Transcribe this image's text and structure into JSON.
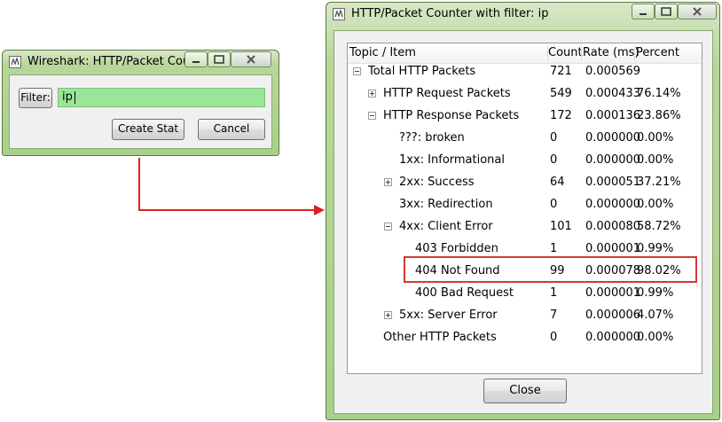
{
  "small_window": {
    "title": "Wireshark: HTTP/Packet Count…",
    "filter_label": "Filter:",
    "filter_value": "ip",
    "create_stat_label": "Create Stat",
    "cancel_label": "Cancel"
  },
  "main_window": {
    "title": "HTTP/Packet Counter with filter: ip",
    "columns": [
      "Topic / Item",
      "Count",
      "Rate (ms)",
      "Percent"
    ],
    "rows": [
      {
        "label": "Total HTTP Packets",
        "count": "721",
        "rate": "0.000569",
        "percent": ""
      },
      {
        "label": "HTTP Request Packets",
        "count": "549",
        "rate": "0.000433",
        "percent": "76.14%"
      },
      {
        "label": "HTTP Response Packets",
        "count": "172",
        "rate": "0.000136",
        "percent": "23.86%"
      },
      {
        "label": "???: broken",
        "count": "0",
        "rate": "0.000000",
        "percent": "0.00%"
      },
      {
        "label": "1xx: Informational",
        "count": "0",
        "rate": "0.000000",
        "percent": "0.00%"
      },
      {
        "label": "2xx: Success",
        "count": "64",
        "rate": "0.000051",
        "percent": "37.21%"
      },
      {
        "label": "3xx: Redirection",
        "count": "0",
        "rate": "0.000000",
        "percent": "0.00%"
      },
      {
        "label": "4xx: Client Error",
        "count": "101",
        "rate": "0.000080",
        "percent": "58.72%"
      },
      {
        "label": "403 Forbidden",
        "count": "1",
        "rate": "0.000001",
        "percent": "0.99%"
      },
      {
        "label": "404 Not Found",
        "count": "99",
        "rate": "0.000078",
        "percent": "98.02%"
      },
      {
        "label": "400 Bad Request",
        "count": "1",
        "rate": "0.000001",
        "percent": "0.99%"
      },
      {
        "label": "5xx: Server Error",
        "count": "7",
        "rate": "0.000006",
        "percent": "4.07%"
      },
      {
        "label": "Other HTTP Packets",
        "count": "0",
        "rate": "0.000000",
        "percent": "0.00%"
      }
    ],
    "close_label": "Close"
  },
  "colors": {
    "window_frame": "#a8d08a",
    "filter_valid": "#99e699",
    "annotation": "#d43a34"
  }
}
